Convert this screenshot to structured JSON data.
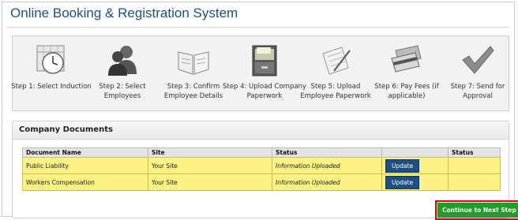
{
  "app": {
    "title": "Online Booking & Registration System"
  },
  "steps": [
    {
      "label": "Step 1: Select Induction",
      "icon": "clock-calendar-icon"
    },
    {
      "label": "Step 2: Select Employees",
      "icon": "people-icon"
    },
    {
      "label": "Step 3: Confirm Employee Details",
      "icon": "open-book-icon"
    },
    {
      "label": "Step 4: Upload Company Paperwork",
      "icon": "file-cabinet-icon"
    },
    {
      "label": "Step 5: Upload Employee Paperwork",
      "icon": "document-pen-icon"
    },
    {
      "label": "Step 6: Pay Fees (if applicable)",
      "icon": "credit-card-icon"
    },
    {
      "label": "Step 7: Send for Approval",
      "icon": "checkmark-icon"
    }
  ],
  "documents": {
    "title": "Company Documents",
    "columns": [
      "Document Name",
      "Site",
      "Status",
      "",
      "Status"
    ],
    "rows": [
      {
        "name": "Public Liability",
        "site": "Your Site",
        "status": "Information Uploaded",
        "action": "Update",
        "status2": ""
      },
      {
        "name": "Workers Compensation",
        "site": "Your Site",
        "status": "Information Uploaded",
        "action": "Update",
        "status2": ""
      }
    ]
  },
  "next_button": {
    "label": "Continue to Next Step"
  },
  "colors": {
    "accent": "#1f4f7b",
    "row_highlight": "#fbf283",
    "next": "#1f9d25",
    "highlight_border": "#e00000"
  }
}
